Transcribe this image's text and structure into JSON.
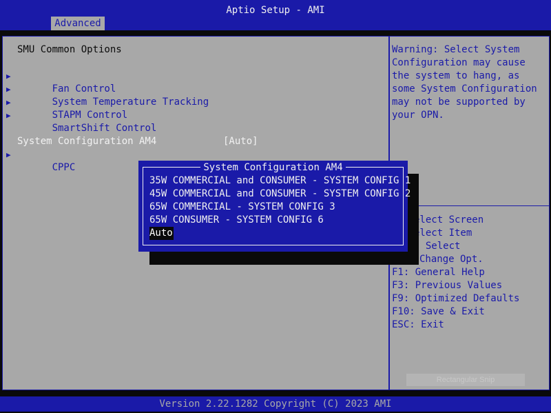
{
  "header": {
    "title": "Aptio Setup - AMI",
    "tabs": [
      {
        "label": "Advanced",
        "active": true
      }
    ]
  },
  "left_panel": {
    "heading": "SMU Common Options",
    "submenus": [
      {
        "label": "Fan Control"
      },
      {
        "label": "System Temperature Tracking"
      },
      {
        "label": "STAPM Control"
      },
      {
        "label": "SmartShift Control"
      }
    ],
    "option": {
      "label": "System Configuration AM4",
      "value": "[Auto]"
    },
    "submenu_after": {
      "label": "CPPC"
    }
  },
  "popup": {
    "title": "System Configuration AM4",
    "options": [
      "35W COMMERCIAL and CONSUMER - SYSTEM CONFIG 1",
      "45W COMMERCIAL and CONSUMER - SYSTEM CONFIG 2",
      "65W COMMERCIAL - SYSTEM CONFIG 3",
      "65W CONSUMER - SYSTEM CONFIG 6",
      "Auto"
    ],
    "selected": "Auto"
  },
  "right_panel": {
    "help_text": "Warning: Select System Configuration may cause the system to hang, as some System Configuration may not be supported by your OPN.",
    "keys": [
      "elect Screen",
      "elect Item",
      ": Select",
      "Change Opt.",
      "F1: General Help",
      "F3: Previous Values",
      "F9: Optimized Defaults",
      "F10: Save & Exit",
      "ESC: Exit"
    ]
  },
  "footer": {
    "version": "Version 2.22.1282 Copyright (C) 2023 AMI"
  },
  "overlay": {
    "snip_label": "Rectangular Snip"
  },
  "colors": {
    "bios_blue": "#1a1aa8",
    "bios_gray": "#a8a8a8",
    "highlight_bg": "#0a0a0a",
    "text_white": "#f0f0f0"
  }
}
